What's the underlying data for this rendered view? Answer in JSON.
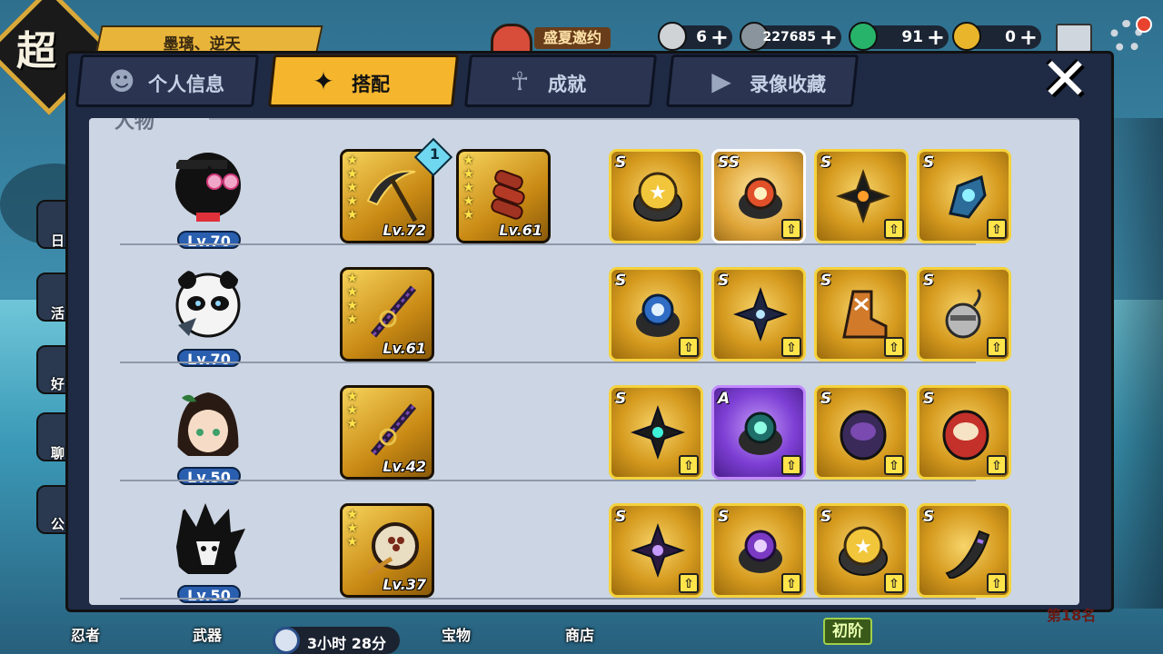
{
  "header": {
    "logo_char": "超",
    "player_name": "墨璃、逆天",
    "event_label": "盛夏邀约",
    "resources": [
      {
        "name": "rice-ball",
        "value": "6",
        "color": "#cfd3d6"
      },
      {
        "name": "silver-coin",
        "value": "227685",
        "color": "#8a949c"
      },
      {
        "name": "green-gem",
        "value": "91",
        "color": "#27b36a"
      },
      {
        "name": "gold-gem",
        "value": "0",
        "color": "#e9b52a"
      }
    ]
  },
  "tabs": [
    {
      "label": "个人信息",
      "icon": "person-card-icon"
    },
    {
      "label": "搭配",
      "icon": "shuriken-icon",
      "active": true
    },
    {
      "label": "成就",
      "icon": "trophy-icon"
    },
    {
      "label": "录像收藏",
      "icon": "play-icon"
    }
  ],
  "section_title": "人物",
  "roster": [
    {
      "level": "Lv.70",
      "weapons": [
        {
          "level": "Lv.72",
          "stars": 5,
          "badge": "1",
          "kind": "scythe"
        },
        {
          "level": "Lv.61",
          "stars": 5,
          "kind": "meat-skewer"
        }
      ],
      "items": [
        {
          "grade": "S",
          "kind": "star-ring"
        },
        {
          "grade": "SS",
          "kind": "fire-ring"
        },
        {
          "grade": "S",
          "kind": "flame-shuriken"
        },
        {
          "grade": "S",
          "kind": "ice-gauntlet"
        }
      ]
    },
    {
      "level": "Lv.70",
      "weapons": [
        {
          "level": "Lv.61",
          "stars": 4,
          "kind": "katana"
        }
      ],
      "items": [
        {
          "grade": "S",
          "kind": "blue-ring"
        },
        {
          "grade": "S",
          "kind": "lightning-shuriken"
        },
        {
          "grade": "S",
          "kind": "boot"
        },
        {
          "grade": "S",
          "kind": "bomb"
        }
      ]
    },
    {
      "level": "Lv.50",
      "weapons": [
        {
          "level": "Lv.42",
          "stars": 3,
          "kind": "katana"
        }
      ],
      "items": [
        {
          "grade": "S",
          "kind": "teal-shuriken"
        },
        {
          "grade": "A",
          "kind": "green-ring"
        },
        {
          "grade": "S",
          "kind": "purple-daruma"
        },
        {
          "grade": "S",
          "kind": "red-daruma"
        }
      ]
    },
    {
      "level": "Lv.50",
      "weapons": [
        {
          "level": "Lv.37",
          "stars": 3,
          "kind": "drum"
        }
      ],
      "items": [
        {
          "grade": "S",
          "kind": "purple-shuriken"
        },
        {
          "grade": "S",
          "kind": "violet-ring"
        },
        {
          "grade": "S",
          "kind": "star-ring"
        },
        {
          "grade": "S",
          "kind": "horn"
        }
      ]
    }
  ],
  "footer": {
    "nav": [
      "忍者",
      "武器",
      "宝物",
      "商店"
    ],
    "timer": "3小时 28分",
    "rank_tier": "初阶",
    "rank_no": "第18名"
  },
  "side_labels": [
    "日",
    "活",
    "好",
    "聊",
    "公"
  ],
  "colors": {
    "accent": "#f5b62e",
    "panel": "#1f2a44",
    "content_bg": "#ccd5e3",
    "level_badge": "#2a5fb0"
  }
}
